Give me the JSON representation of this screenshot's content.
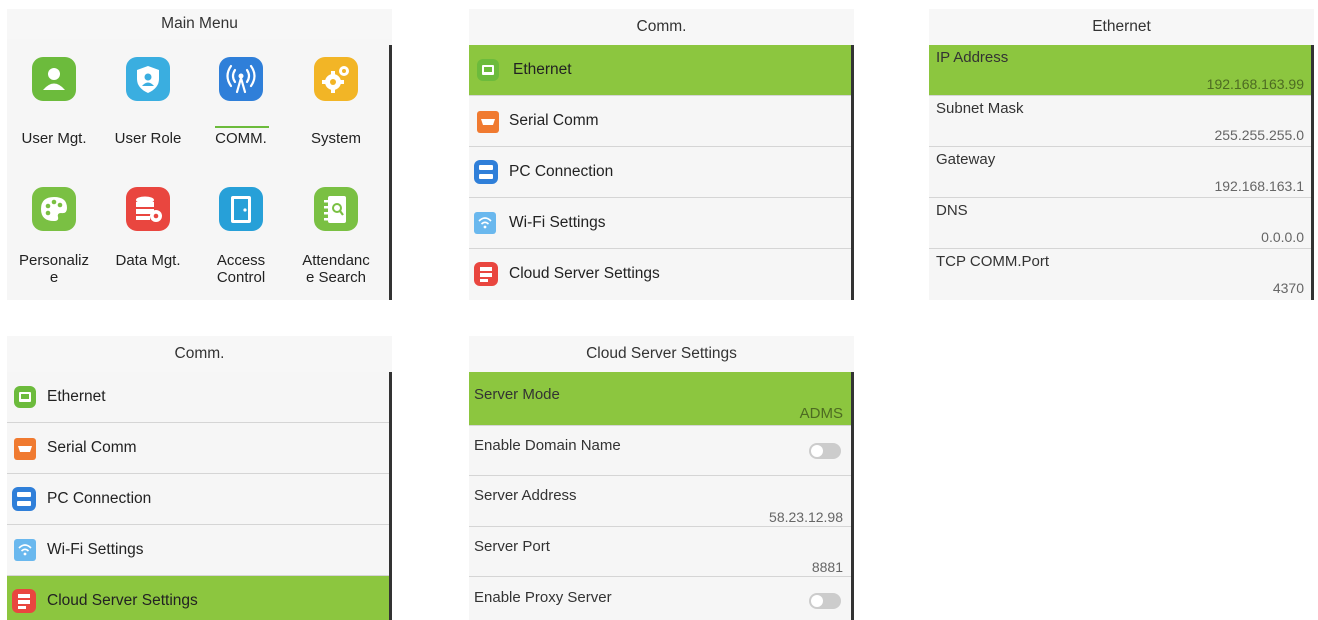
{
  "main_menu": {
    "title": "Main Menu",
    "items": [
      {
        "label": "User Mgt.",
        "icon": "user-icon",
        "color": "#6cbb3c"
      },
      {
        "label": "User Role",
        "icon": "shield-user-icon",
        "color": "#3aaee0"
      },
      {
        "label": "COMM.",
        "icon": "antenna-icon",
        "color": "#2f7fd9"
      },
      {
        "label": "System",
        "icon": "gears-icon",
        "color": "#f2b526"
      },
      {
        "label": "Personaliz\ne",
        "icon": "palette-icon",
        "color": "#7ac043"
      },
      {
        "label": "Data Mgt.",
        "icon": "database-gear-icon",
        "color": "#e9463f"
      },
      {
        "label": "Access\nControl",
        "icon": "door-icon",
        "color": "#27a0d8"
      },
      {
        "label": "Attendanc\ne Search",
        "icon": "notebook-search-icon",
        "color": "#7ac043"
      }
    ]
  },
  "comm_top": {
    "title": "Comm.",
    "items": [
      {
        "label": "Ethernet",
        "icon": "ethernet-icon",
        "color": "#6cbb3c"
      },
      {
        "label": "Serial Comm",
        "icon": "serial-port-icon",
        "color": "#f07a30"
      },
      {
        "label": "PC Connection",
        "icon": "pc-connection-icon",
        "color": "#2f7fd9"
      },
      {
        "label": "Wi-Fi Settings",
        "icon": "wifi-icon",
        "color": "#6ab8ee"
      },
      {
        "label": "Cloud Server Settings",
        "icon": "cloud-server-icon",
        "color": "#e9463f"
      }
    ]
  },
  "ethernet": {
    "title": "Ethernet",
    "fields": [
      {
        "label": "IP Address",
        "value": "192.168.163.99"
      },
      {
        "label": "Subnet Mask",
        "value": "255.255.255.0"
      },
      {
        "label": "Gateway",
        "value": "192.168.163.1"
      },
      {
        "label": "DNS",
        "value": "0.0.0.0"
      },
      {
        "label": "TCP COMM.Port",
        "value": "4370"
      }
    ]
  },
  "comm_bottom": {
    "title": "Comm.",
    "items": [
      {
        "label": "Ethernet"
      },
      {
        "label": "Serial Comm"
      },
      {
        "label": "PC Connection"
      },
      {
        "label": "Wi-Fi Settings"
      },
      {
        "label": "Cloud Server Settings"
      }
    ]
  },
  "cloud": {
    "title": "Cloud Server Settings",
    "fields": [
      {
        "label": "Server Mode",
        "value": "ADMS"
      },
      {
        "label": "Enable Domain Name",
        "toggle": "off"
      },
      {
        "label": "Server Address",
        "value": "58.23.12.98"
      },
      {
        "label": "Server Port",
        "value": "8881"
      },
      {
        "label": "Enable Proxy Server",
        "toggle": "off"
      }
    ]
  },
  "colors": {
    "highlight": "#8cc63f",
    "panel_bg": "#f6f6f6",
    "divider": "#d5d5d5"
  }
}
